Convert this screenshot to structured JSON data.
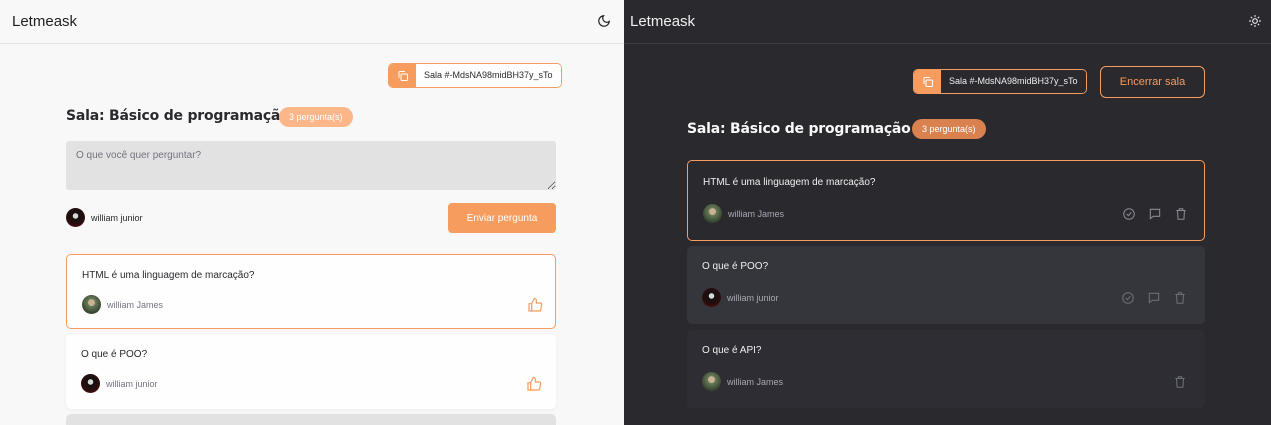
{
  "light": {
    "logo": "Letmeask",
    "theme_icon": "moon-icon",
    "room_code": "Sala #-MdsNA98midBH37y_sTo",
    "room_title": "Sala: Básico de programação",
    "question_count": "3 pergunta(s)",
    "input_placeholder": "O que você quer perguntar?",
    "current_user": "william junior",
    "send_button": "Enviar pergunta",
    "questions": [
      {
        "text": "HTML é uma linguagem de marcação?",
        "author": "william James"
      },
      {
        "text": "O que é POO?",
        "author": "william junior"
      }
    ]
  },
  "dark": {
    "logo": "Letmeask",
    "theme_icon": "sun-icon",
    "room_code": "Sala #-MdsNA98midBH37y_sTo",
    "close_room": "Encerrar sala",
    "room_title": "Sala: Básico de programação",
    "question_count": "3 pergunta(s)",
    "questions": [
      {
        "text": "HTML é uma linguagem de marcação?",
        "author": "william James"
      },
      {
        "text": "O que é POO?",
        "author": "william junior"
      },
      {
        "text": "O que é API?",
        "author": "william James"
      }
    ]
  },
  "colors": {
    "accent": "#f79c5f",
    "badge_light": "#fbb78a",
    "badge_dark": "#d9824f",
    "dark_bg": "#29292e",
    "dark_card": "#33333a",
    "light_bg": "#f8f8f8"
  }
}
